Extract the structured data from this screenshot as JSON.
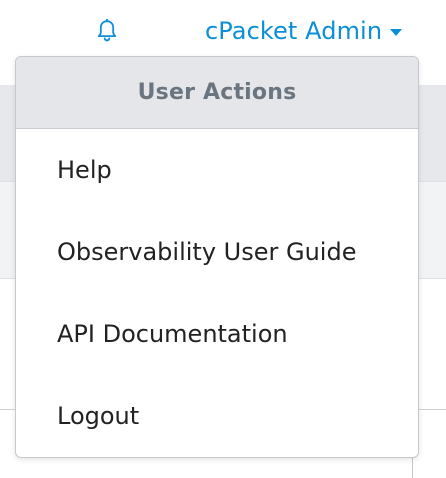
{
  "navbar": {
    "notifications_icon": "bell-icon",
    "user_menu_label": "cPacket Admin",
    "user_menu_caret_icon": "caret-down-icon",
    "accent_color": "#0b8fd6"
  },
  "dropdown": {
    "header": "User Actions",
    "items": [
      {
        "label": "Help"
      },
      {
        "label": "Observability User Guide"
      },
      {
        "label": "API Documentation"
      },
      {
        "label": "Logout"
      }
    ]
  }
}
